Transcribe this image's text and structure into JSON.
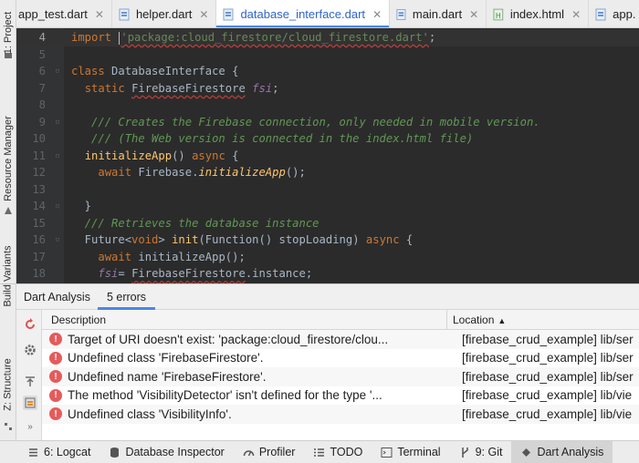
{
  "left_strip": {
    "tabs": [
      {
        "label": "1: Project",
        "icon": "folder-icon"
      },
      {
        "label": "Resource Manager",
        "icon": "resource-icon"
      },
      {
        "label": "Build Variants",
        "icon": "build-variants-icon"
      },
      {
        "label": "Z: Structure",
        "icon": "structure-icon"
      }
    ]
  },
  "editor_tabs": [
    {
      "label": "app_test.dart",
      "icon": "dart-file-icon",
      "active": false
    },
    {
      "label": "helper.dart",
      "icon": "dart-file-icon",
      "active": false
    },
    {
      "label": "database_interface.dart",
      "icon": "dart-file-icon",
      "active": true
    },
    {
      "label": "main.dart",
      "icon": "dart-file-icon",
      "active": false
    },
    {
      "label": "index.html",
      "icon": "html-file-icon",
      "active": false
    },
    {
      "label": "app.",
      "icon": "dart-file-icon",
      "active": false
    }
  ],
  "editor": {
    "lines": [
      {
        "n": "4",
        "segs": [
          [
            "kw",
            "import "
          ],
          [
            "caret",
            ""
          ],
          [
            "str",
            "'package:cloud_firestore/cloud_firestore.dart'"
          ],
          [
            "p",
            ";"
          ]
        ],
        "current": true
      },
      {
        "n": "5",
        "segs": []
      },
      {
        "n": "6",
        "segs": [
          [
            "kw",
            "class "
          ],
          [
            "cls",
            "DatabaseInterface "
          ],
          [
            "p",
            "{"
          ]
        ]
      },
      {
        "n": "7",
        "segs": [
          [
            "p",
            "  "
          ],
          [
            "kw",
            "static "
          ],
          [
            "err",
            "FirebaseFirestore"
          ],
          [
            "p",
            " "
          ],
          [
            "fld",
            "fsi"
          ],
          [
            "p",
            ";"
          ]
        ]
      },
      {
        "n": "8",
        "segs": []
      },
      {
        "n": "9",
        "segs": [
          [
            "p",
            "   "
          ],
          [
            "cmt",
            "/// Creates the Firebase connection, only needed in mobile version."
          ]
        ]
      },
      {
        "n": "10",
        "segs": [
          [
            "p",
            "   "
          ],
          [
            "cmt",
            "/// (The Web version is connected in the index.html file)"
          ]
        ]
      },
      {
        "n": "11",
        "segs": [
          [
            "p",
            "  "
          ],
          [
            "fn",
            "initializeApp"
          ],
          [
            "p",
            "() "
          ],
          [
            "kw",
            "async "
          ],
          [
            "p",
            "{"
          ]
        ]
      },
      {
        "n": "12",
        "segs": [
          [
            "p",
            "    "
          ],
          [
            "kw",
            "await "
          ],
          [
            "p",
            "Firebase."
          ],
          [
            "fni",
            "initializeApp"
          ],
          [
            "p",
            "();"
          ]
        ]
      },
      {
        "n": "13",
        "segs": []
      },
      {
        "n": "14",
        "segs": [
          [
            "p",
            "  }"
          ]
        ]
      },
      {
        "n": "15",
        "segs": [
          [
            "p",
            "  "
          ],
          [
            "cmt",
            "/// Retrieves the database instance"
          ]
        ]
      },
      {
        "n": "16",
        "segs": [
          [
            "p",
            "  Future<"
          ],
          [
            "kw",
            "void"
          ],
          [
            "p",
            "> "
          ],
          [
            "fn",
            "init"
          ],
          [
            "p",
            "(Function() stopLoading) "
          ],
          [
            "kw",
            "async "
          ],
          [
            "p",
            "{"
          ]
        ]
      },
      {
        "n": "17",
        "segs": [
          [
            "p",
            "    "
          ],
          [
            "kw",
            "await "
          ],
          [
            "p",
            "initializeApp();"
          ]
        ]
      },
      {
        "n": "18",
        "segs": [
          [
            "p",
            "    "
          ],
          [
            "fld",
            "fsi"
          ],
          [
            "p",
            "= "
          ],
          [
            "err",
            "FirebaseFirestore"
          ],
          [
            "p",
            ".instance;"
          ]
        ]
      }
    ]
  },
  "panel": {
    "title": "Dart Analysis",
    "tab": "5 errors",
    "columns": {
      "description": "Description",
      "location": "Location"
    },
    "rows": [
      {
        "description": "Target of URI doesn't exist: 'package:cloud_firestore/clou...",
        "location": "[firebase_crud_example] lib/ser"
      },
      {
        "description": "Undefined class 'FirebaseFirestore'.",
        "location": "[firebase_crud_example] lib/ser"
      },
      {
        "description": "Undefined name 'FirebaseFirestore'.",
        "location": "[firebase_crud_example] lib/ser"
      },
      {
        "description": "The method 'VisibilityDetector' isn't defined for the type '...",
        "location": "[firebase_crud_example] lib/vie"
      },
      {
        "description": "Undefined class 'VisibilityInfo'.",
        "location": "[firebase_crud_example] lib/vie"
      }
    ],
    "tools": [
      "refresh-icon",
      "settings-icon",
      "scroll-to-source-icon",
      "group-by-icon",
      "more-icon"
    ]
  },
  "bottom_bar": [
    {
      "label": "6: Logcat",
      "icon": "logcat-icon"
    },
    {
      "label": "Database Inspector",
      "icon": "database-icon"
    },
    {
      "label": "Profiler",
      "icon": "profiler-icon"
    },
    {
      "label": "TODO",
      "icon": "todo-icon"
    },
    {
      "label": "Terminal",
      "icon": "terminal-icon"
    },
    {
      "label": "9: Git",
      "icon": "git-icon"
    },
    {
      "label": "Dart Analysis",
      "icon": "dart-analysis-icon",
      "active": true
    }
  ],
  "colors": {
    "editor_bg": "#2b2b2b",
    "keyword": "#cc7832",
    "string": "#6a8759",
    "comment": "#629755",
    "error": "#e55b5b",
    "accent": "#4a86e8"
  }
}
